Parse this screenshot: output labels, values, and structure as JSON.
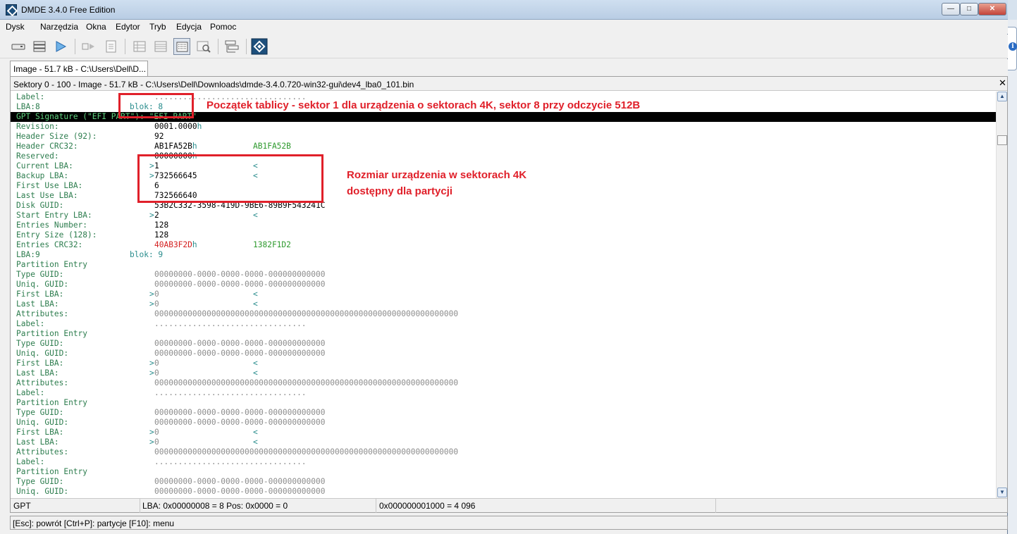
{
  "window": {
    "title": "DMDE 3.4.0 Free Edition",
    "controls": {
      "minimize": "—",
      "maximize": "□",
      "close": "✕"
    }
  },
  "menu": [
    "Dysk",
    "Narzędzia",
    "Okna",
    "Edytor",
    "Tryb",
    "Edycja",
    "Pomoc"
  ],
  "toolbar": {
    "icons": [
      "disk-icon",
      "partitions-icon",
      "play-icon",
      "forward-icon",
      "new-file-icon",
      "table-icon",
      "grid-icon",
      "sector-view-icon",
      "search-icon",
      "layout-icon",
      "dmde-logo-icon"
    ]
  },
  "tab": {
    "label": "Image - 51.7 kB - C:\\Users\\Dell\\D..."
  },
  "panel": {
    "title": "Sektory 0 - 100 - Image - 51.7 kB - C:\\Users\\Dell\\Downloads\\dmde-3.4.0.720-win32-gui\\dev4_lba0_101.bin",
    "close": "✕"
  },
  "rows": [
    {
      "label": "Label:",
      "val": "................................",
      "valClass": "gray"
    },
    {
      "label": "LBA:8",
      "blok": "blok: 8"
    },
    {
      "label": "GPT Signature (\"EFI PART\"): \"EFI PART\"",
      "highlight": true
    },
    {
      "label": "Revision:",
      "val": "0001.0000",
      "hsuf": "h"
    },
    {
      "label": "Header Size (92):",
      "val": "92"
    },
    {
      "label": "Header CRC32:",
      "val": "AB1FA52B",
      "hsuf": "h",
      "alt": "AB1FA52B"
    },
    {
      "label": "Reserved:",
      "val": "00000000",
      "hsuf": "h"
    },
    {
      "label": "Current LBA:",
      "mark": ">",
      "val": "1",
      "end": "<"
    },
    {
      "label": "Backup LBA:",
      "mark": ">",
      "val": "732566645",
      "end": "<"
    },
    {
      "label": "First Use LBA:",
      "val": "6"
    },
    {
      "label": "Last Use LBA:",
      "val": "732566640"
    },
    {
      "label": "Disk GUID:",
      "val": "53B2C332-3598-419D-9BE6-89B9F543241C"
    },
    {
      "label": "Start Entry LBA:",
      "mark": ">",
      "val": "2",
      "end": "<"
    },
    {
      "label": "Entries Number:",
      "val": "128"
    },
    {
      "label": "Entry Size (128):",
      "val": "128"
    },
    {
      "label": "Entries CRC32:",
      "val": "40AB3F2D",
      "valClass": "red",
      "hsuf": "h",
      "alt": "1382F1D2"
    },
    {
      "label": "LBA:9",
      "blok": "blok: 9"
    },
    {
      "label": "Partition Entry"
    },
    {
      "label": "Type GUID:",
      "val": "00000000-0000-0000-0000-000000000000",
      "valClass": "gray"
    },
    {
      "label": "Uniq. GUID:",
      "val": "00000000-0000-0000-0000-000000000000",
      "valClass": "gray"
    },
    {
      "label": "First LBA:",
      "mark": ">",
      "val": "0",
      "valClass": "gray",
      "end": "<"
    },
    {
      "label": "Last LBA:",
      "mark": ">",
      "val": "0",
      "valClass": "gray",
      "end": "<"
    },
    {
      "label": "Attributes:",
      "val": "0000000000000000000000000000000000000000000000000000000000000000",
      "valClass": "gray"
    },
    {
      "label": "Label:",
      "val": "................................",
      "valClass": "gray"
    },
    {
      "label": "Partition Entry"
    },
    {
      "label": "Type GUID:",
      "val": "00000000-0000-0000-0000-000000000000",
      "valClass": "gray"
    },
    {
      "label": "Uniq. GUID:",
      "val": "00000000-0000-0000-0000-000000000000",
      "valClass": "gray"
    },
    {
      "label": "First LBA:",
      "mark": ">",
      "val": "0",
      "valClass": "gray",
      "end": "<"
    },
    {
      "label": "Last LBA:",
      "mark": ">",
      "val": "0",
      "valClass": "gray",
      "end": "<"
    },
    {
      "label": "Attributes:",
      "val": "0000000000000000000000000000000000000000000000000000000000000000",
      "valClass": "gray"
    },
    {
      "label": "Label:",
      "val": "................................",
      "valClass": "gray"
    },
    {
      "label": "Partition Entry"
    },
    {
      "label": "Type GUID:",
      "val": "00000000-0000-0000-0000-000000000000",
      "valClass": "gray"
    },
    {
      "label": "Uniq. GUID:",
      "val": "00000000-0000-0000-0000-000000000000",
      "valClass": "gray"
    },
    {
      "label": "First LBA:",
      "mark": ">",
      "val": "0",
      "valClass": "gray",
      "end": "<"
    },
    {
      "label": "Last LBA:",
      "mark": ">",
      "val": "0",
      "valClass": "gray",
      "end": "<"
    },
    {
      "label": "Attributes:",
      "val": "0000000000000000000000000000000000000000000000000000000000000000",
      "valClass": "gray"
    },
    {
      "label": "Label:",
      "val": "................................",
      "valClass": "gray"
    },
    {
      "label": "Partition Entry"
    },
    {
      "label": "Type GUID:",
      "val": "00000000-0000-0000-0000-000000000000",
      "valClass": "gray"
    },
    {
      "label": "Uniq. GUID:",
      "val": "00000000-0000-0000-0000-000000000000",
      "valClass": "gray"
    }
  ],
  "status": {
    "mode": "GPT",
    "position": "LBA: 0x00000008 = 8  Pos: 0x0000 = 0",
    "value": "0x000000001000 = 4 096"
  },
  "hint": "[Esc]: powrót  [Ctrl+P]: partycje  [F10]: menu",
  "annotations": {
    "start_note": "Początek tablicy - sektor 1 dla urządzenia o sektorach 4K, sektor 8 przy odczycie 512B",
    "size_note_line1": "Rozmiar urządzenia w sektorach 4K",
    "size_note_line2": "dostępny dla partycji",
    "color": "#e0202a"
  }
}
